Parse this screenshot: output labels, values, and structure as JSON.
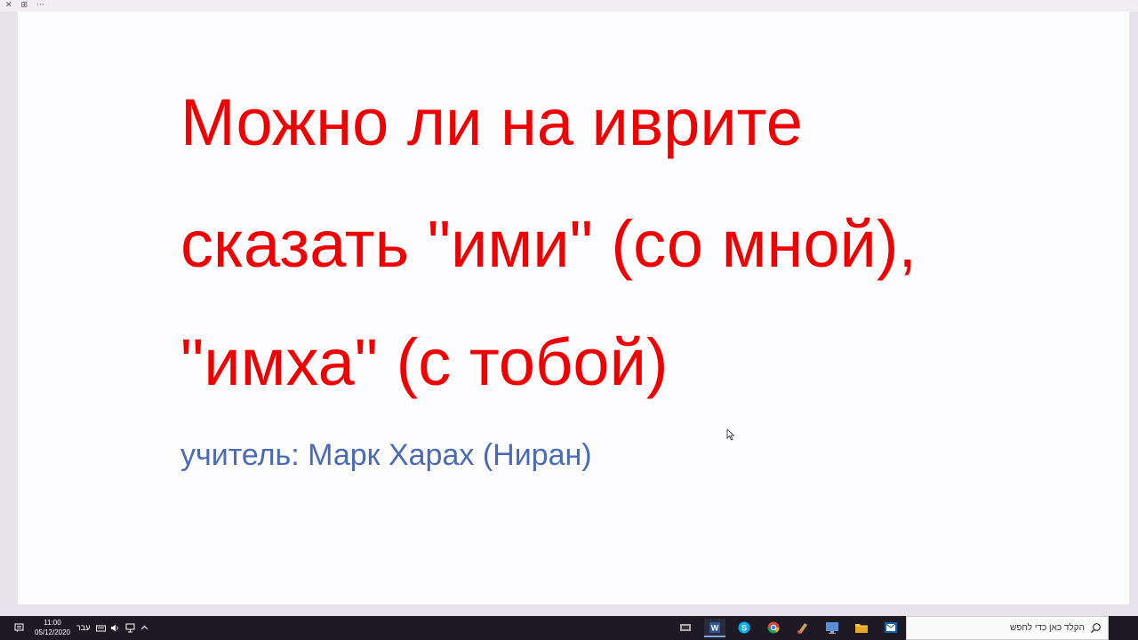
{
  "window": {
    "controls": [
      "✕",
      "⊞",
      "···"
    ]
  },
  "slide": {
    "title_lines": [
      "Можно ли на иврите",
      "сказать \"ими\" (со мной),",
      "\"имха\" (с тобой)"
    ],
    "teacher": "учитель: Марк Харах (Ниран)",
    "title_color": "#ee0000",
    "teacher_color": "#4a6ab8"
  },
  "taskbar": {
    "time": "11:00",
    "date": "05/12/2020",
    "language": "עבר",
    "search_placeholder": "הקלד כאן כדי לחפש",
    "apps": [
      "task-view-icon",
      "word-icon",
      "skype-icon",
      "chrome-icon",
      "paint-icon",
      "monitor-icon",
      "file-explorer-icon",
      "outlook-icon"
    ],
    "tray_icons": [
      "notification-icon",
      "keyboard-icon",
      "volume-icon",
      "network-icon",
      "chevron-up-icon"
    ]
  }
}
